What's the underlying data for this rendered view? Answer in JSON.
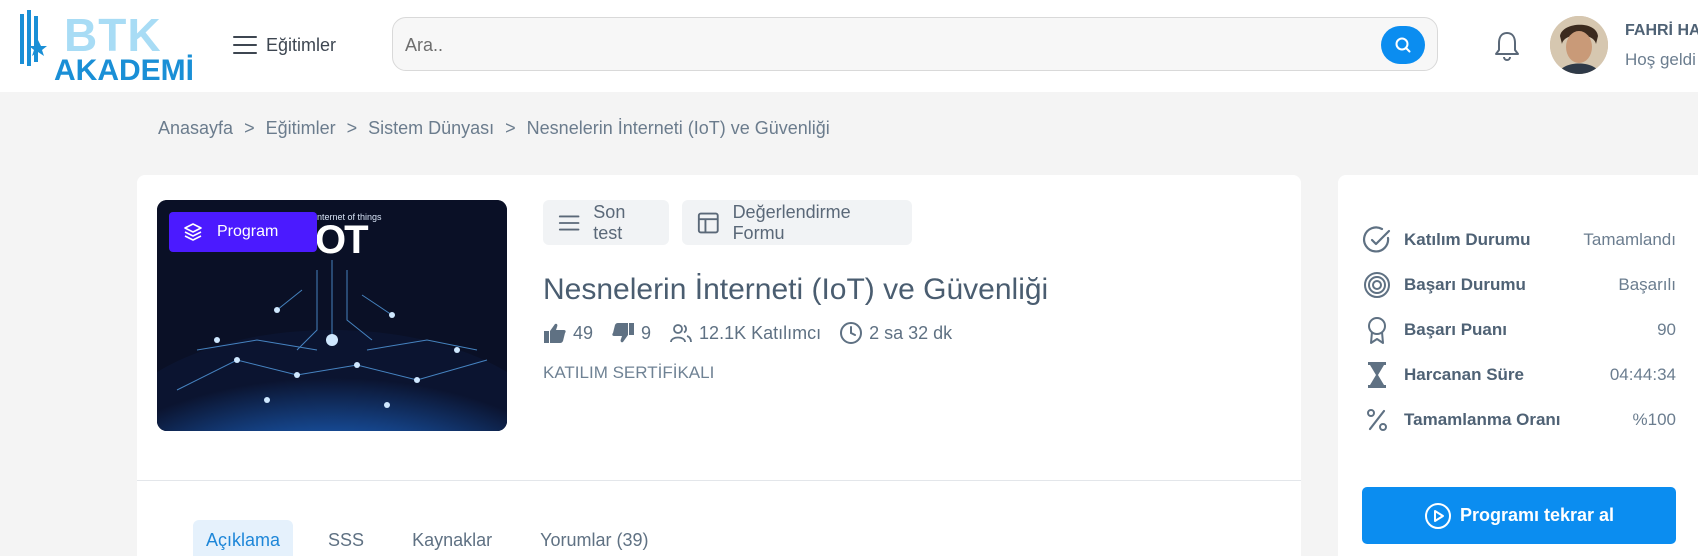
{
  "header": {
    "logo_top": "BTK",
    "logo_bottom": "AKADEMİ",
    "menu_label": "Eğitimler",
    "search_placeholder": "Ara..",
    "user_name": "FAHRİ HA",
    "user_greeting": "Hoş geldi"
  },
  "breadcrumb": [
    "Anasayfa",
    "Eğitimler",
    "Sistem Dünyası",
    "Nesnelerin İnterneti (IoT) ve Güvenliği"
  ],
  "course": {
    "badge": "Program",
    "thumb_small": "nternet of things",
    "thumb_big": "OT",
    "actions": {
      "test": "Son test",
      "form": "Değerlendirme Formu"
    },
    "title": "Nesnelerin İnterneti (IoT) ve Güvenliği",
    "likes": "49",
    "dislikes": "9",
    "participants": "12.1K Katılımcı",
    "duration": "2 sa 32 dk",
    "certificate": "KATILIM SERTİFİKALI"
  },
  "tabs": [
    "Açıklama",
    "SSS",
    "Kaynaklar",
    "Yorumlar (39)"
  ],
  "active_tab": "Açıklama",
  "side": {
    "rows": [
      {
        "icon": "check-circle-icon",
        "label": "Katılım Durumu",
        "value": "Tamamlandı"
      },
      {
        "icon": "target-icon",
        "label": "Başarı Durumu",
        "value": "Başarılı"
      },
      {
        "icon": "award-icon",
        "label": "Başarı Puanı",
        "value": "90"
      },
      {
        "icon": "hourglass-icon",
        "label": "Harcanan Süre",
        "value": "04:44:34"
      },
      {
        "icon": "percent-icon",
        "label": "Tamamlanma Oranı",
        "value": "%100"
      }
    ],
    "button": "Programı tekrar al"
  },
  "colors": {
    "primary": "#0b8df0",
    "badge": "#4b1aff",
    "text": "#4f6275"
  }
}
